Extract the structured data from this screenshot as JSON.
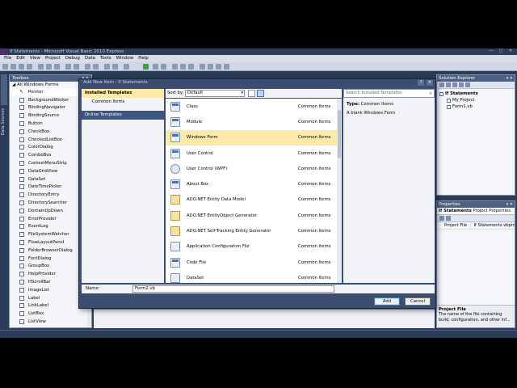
{
  "window": {
    "title": "If Statements - Microsoft Visual Basic 2010 Express"
  },
  "menu": [
    "File",
    "Edit",
    "View",
    "Project",
    "Debug",
    "Data",
    "Tools",
    "Window",
    "Help"
  ],
  "side_tabs": {
    "data_sources": "Data Sources"
  },
  "toolbox": {
    "title": "Toolbox",
    "group": "◢ All Windows Forms",
    "items": [
      "Pointer",
      "BackgroundWorker",
      "BindingNavigator",
      "BindingSource",
      "Button",
      "CheckBox",
      "CheckedListBox",
      "ColorDialog",
      "ComboBox",
      "ContextMenuStrip",
      "DataGridView",
      "DataSet",
      "DateTimePicker",
      "DirectoryEntry",
      "DirectorySearcher",
      "DomainUpDown",
      "ErrorProvider",
      "EventLog",
      "FileSystemWatcher",
      "FlowLayoutPanel",
      "FolderBrowserDialog",
      "FontDialog",
      "GroupBox",
      "HelpProvider",
      "HScrollBar",
      "ImageList",
      "Label",
      "LinkLabel",
      "ListBox",
      "ListView"
    ]
  },
  "solution_explorer": {
    "title": "Solution Explorer",
    "nodes": [
      "If Statements",
      "My Project",
      "Form1.vb"
    ]
  },
  "properties": {
    "title": "Properties",
    "selected_name": "If Statements",
    "selected_type": "Project Properties",
    "row_key": "Project File",
    "row_value": "If Statements.vbproj",
    "desc_title": "Project File",
    "desc_text": "The name of the file containing build, configuration, and other inf..."
  },
  "dialog": {
    "title": "Add New Item - If Statements",
    "categories": {
      "installed": "Installed Templates",
      "common": "Common Items",
      "online": "Online Templates"
    },
    "sort_label": "Sort by:",
    "sort_value": "Default",
    "search_placeholder": "Search Installed Templates",
    "templates": [
      {
        "name": "Class",
        "category": "Common Items"
      },
      {
        "name": "Module",
        "category": "Common Items"
      },
      {
        "name": "Windows Form",
        "category": "Common Items"
      },
      {
        "name": "User Control",
        "category": "Common Items"
      },
      {
        "name": "User Control (WPF)",
        "category": "Common Items"
      },
      {
        "name": "About Box",
        "category": "Common Items"
      },
      {
        "name": "ADO.NET Entity Data Model",
        "category": "Common Items"
      },
      {
        "name": "ADO.NET EntityObject Generator",
        "category": "Common Items"
      },
      {
        "name": "ADO.NET Self-Tracking Entity Generator",
        "category": "Common Items"
      },
      {
        "name": "Application Configuration File",
        "category": "Common Items"
      },
      {
        "name": "Code File",
        "category": "Common Items"
      },
      {
        "name": "DataSet",
        "category": "Common Items"
      }
    ],
    "type_label": "Type:",
    "type_value": "Common Items",
    "description": "A blank Windows Form",
    "name_label": "Name:",
    "name_value": "Form2.vb",
    "add_label": "Add",
    "cancel_label": "Cancel"
  },
  "colors": {
    "ide_background": "#2b3c59",
    "selection": "#fde9a8",
    "accent": "#3d5585"
  }
}
